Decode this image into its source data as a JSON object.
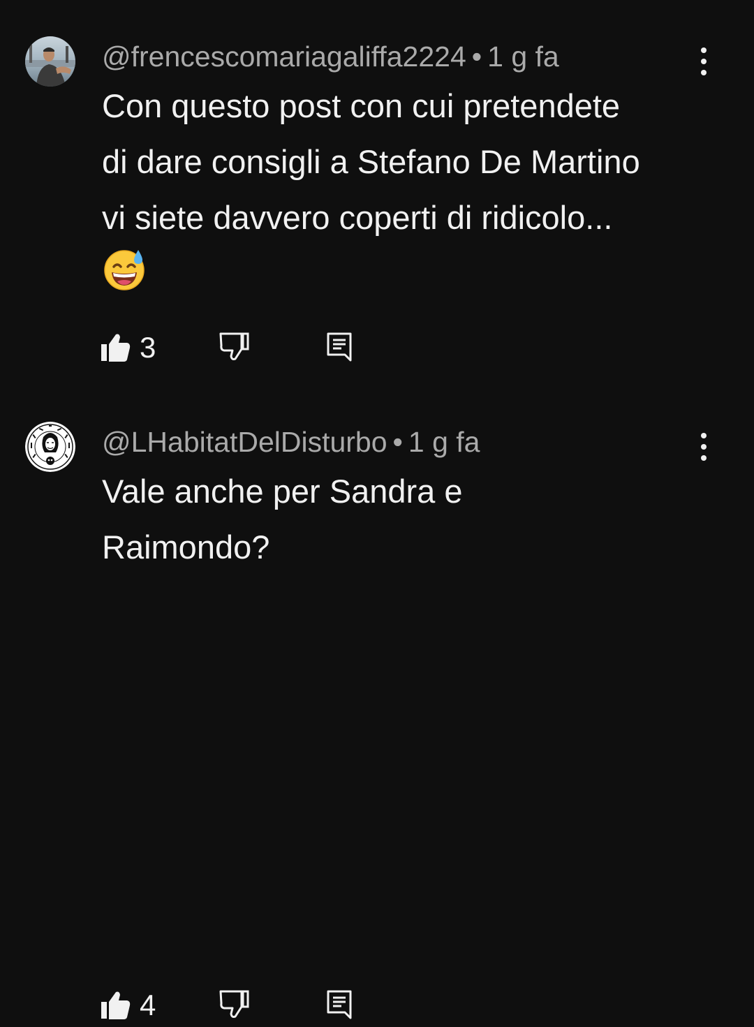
{
  "comments": [
    {
      "author": "@frencescomariagaliffa2224",
      "separator": "•",
      "time": "1 g fa",
      "text": "Con questo post con cui pretendete di dare consigli a Stefano De Martino vi siete davvero coperti di ridicolo...",
      "emoji": "grinning-face-with-sweat-icon",
      "likes": "3",
      "avatar": "photo-avatar-icon"
    },
    {
      "author": "@LHabitatDelDisturbo",
      "separator": "•",
      "time": "1 g fa",
      "text": "Vale anche per Sandra e Raimondo?",
      "likes": "4",
      "avatar": "lhabitat-logo-avatar-icon"
    }
  ],
  "icons": {
    "like": "thumbs-up-icon",
    "dislike": "thumbs-down-icon",
    "reply": "reply-comment-icon",
    "menu": "more-vertical-icon"
  },
  "colors": {
    "background": "#0f0f0f",
    "primary_text": "#f1f1f1",
    "secondary_text": "#aaaaaa"
  }
}
